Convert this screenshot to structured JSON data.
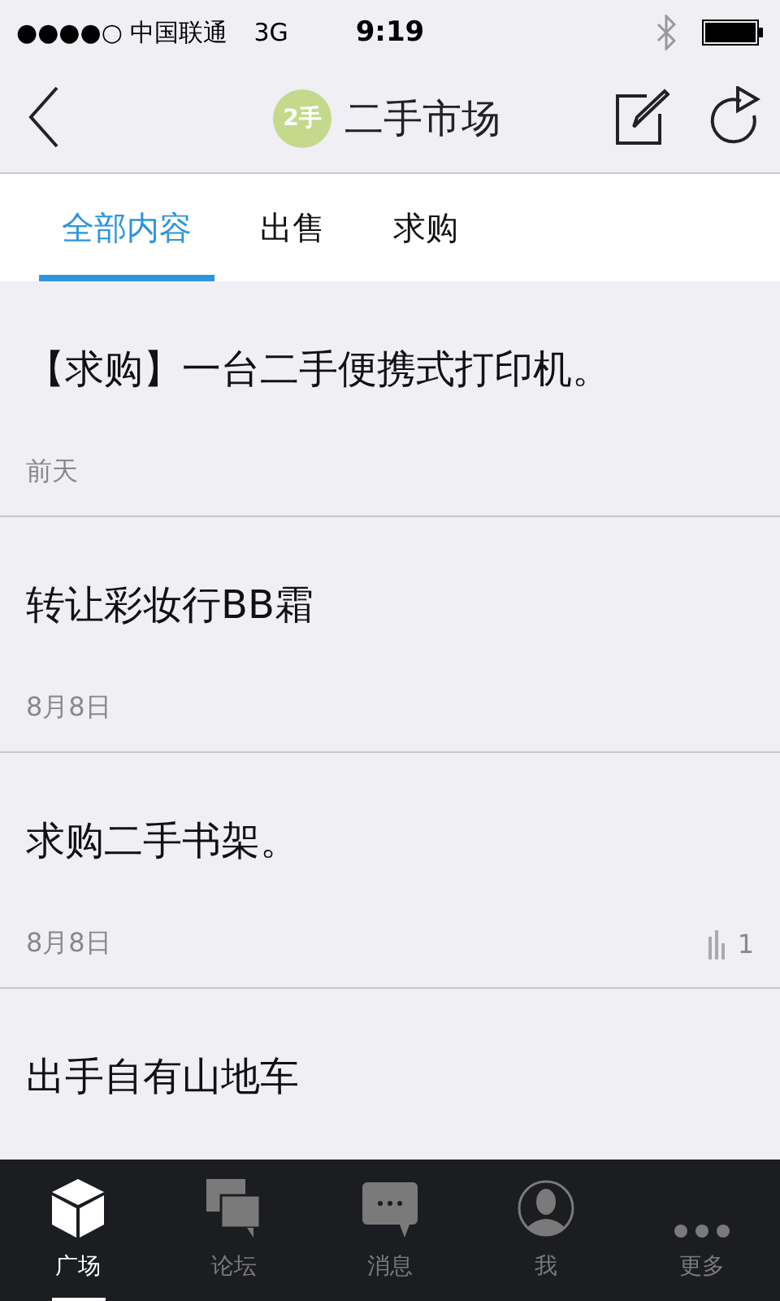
{
  "status_bar": {
    "carrier": "●●●●○ 中国联通",
    "network": "3G",
    "time": "9:19"
  },
  "nav": {
    "logo_text": "2手",
    "title": "二手市场"
  },
  "tabs": [
    {
      "label": "全部内容",
      "selected": true
    },
    {
      "label": "出售",
      "selected": false
    },
    {
      "label": "求购",
      "selected": false
    }
  ],
  "posts": [
    {
      "title": "【求购】一台二手便携式打印机。",
      "date": "前天"
    },
    {
      "title": "转让彩妆行BB霜",
      "date": "8月8日"
    },
    {
      "title": "求购二手书架。",
      "date": "8月8日",
      "views": "1"
    },
    {
      "title": "出手自有山地车"
    }
  ],
  "tab_bar": [
    {
      "label": "广场",
      "kind": "cube",
      "selected": true
    },
    {
      "label": "论坛",
      "kind": "chats",
      "selected": false
    },
    {
      "label": "消息",
      "kind": "message",
      "selected": false
    },
    {
      "label": "我",
      "kind": "person",
      "selected": false
    },
    {
      "label": "更多",
      "kind": "more",
      "selected": false
    }
  ]
}
